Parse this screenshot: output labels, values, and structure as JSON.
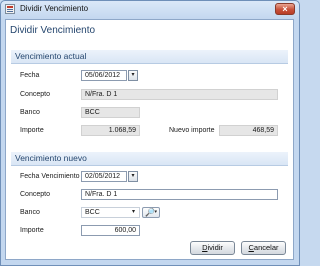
{
  "window": {
    "title": "Dividir Vencimiento",
    "close_glyph": "×",
    "icon": "window-app-icon"
  },
  "header": {
    "title": "Dividir Vencimiento"
  },
  "actual": {
    "section_title": "Vencimiento actual",
    "fecha_label": "Fecha",
    "fecha_value": "05/06/2012",
    "concepto_label": "Concepto",
    "concepto_value": "N/Fra. D 1",
    "banco_label": "Banco",
    "banco_value": "BCC",
    "importe_label": "Importe",
    "importe_value": "1.068,59",
    "nuevo_importe_label": "Nuevo importe",
    "nuevo_importe_value": "468,59"
  },
  "nuevo": {
    "section_title": "Vencimiento nuevo",
    "fecha_label": "Fecha Vencimiento",
    "fecha_value": "02/05/2012",
    "concepto_label": "Concepto",
    "concepto_value": "N/Fra. D 1",
    "banco_label": "Banco",
    "banco_value": "BCC",
    "importe_label": "Importe",
    "importe_value": "600,00"
  },
  "glyphs": {
    "dropdown": "▾",
    "search": "🔎"
  },
  "buttons": {
    "dividir_first": "D",
    "dividir_rest": "ividir",
    "cancelar_first": "C",
    "cancelar_rest": "ancelar"
  }
}
